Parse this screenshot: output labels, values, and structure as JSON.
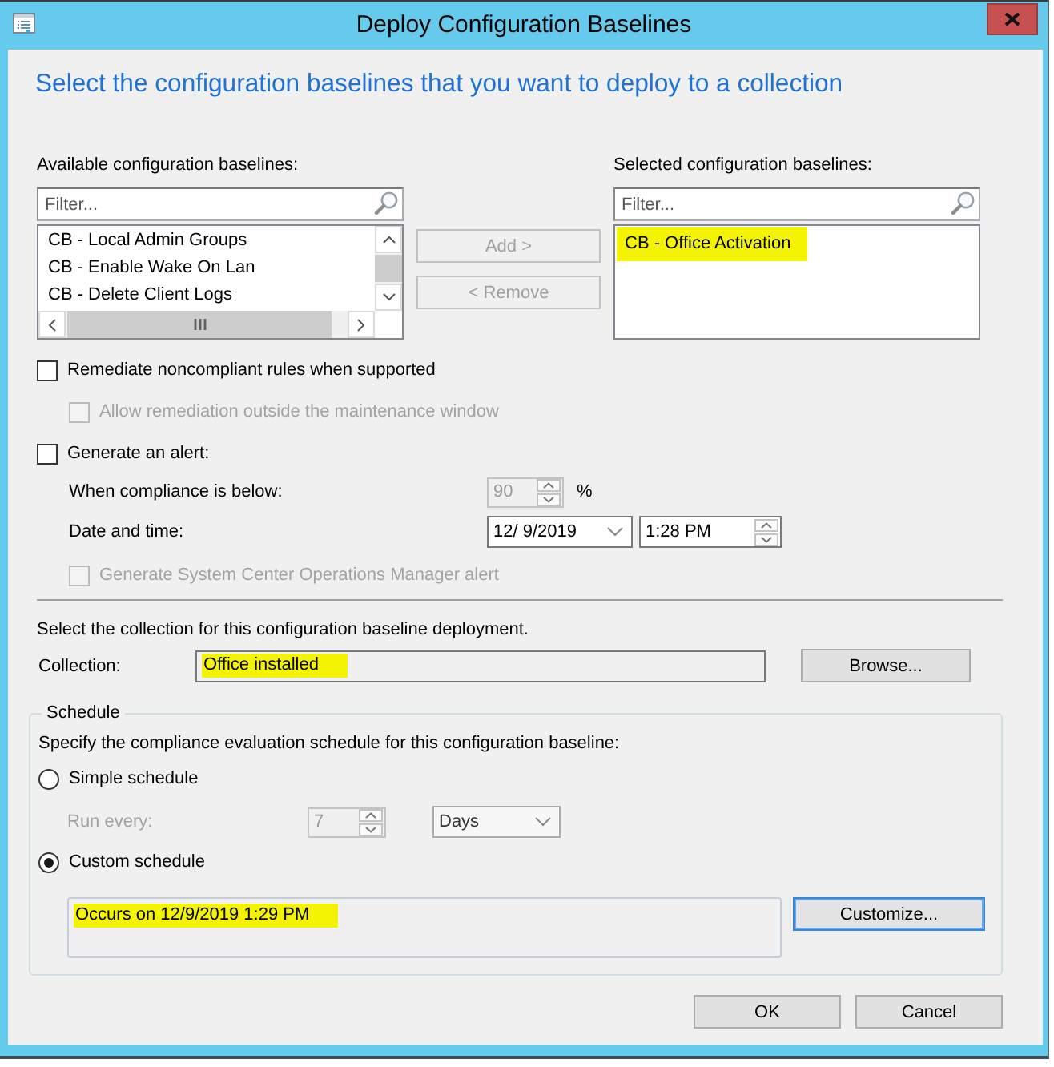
{
  "window": {
    "title": "Deploy Configuration Baselines"
  },
  "heading": "Select the configuration baselines that you want to deploy to a collection",
  "available": {
    "label": "Available configuration baselines:",
    "filter": {
      "placeholder": "Filter..."
    },
    "items": [
      {
        "text": "CB - Local Admin Groups",
        "selected": false
      },
      {
        "text": "CB - Enable Wake On Lan",
        "selected": false
      },
      {
        "text": "CB - Delete Client Logs",
        "selected": false
      }
    ]
  },
  "move_buttons": [
    {
      "label": "Add >",
      "disabled": true
    },
    {
      "label": "< Remove",
      "disabled": true
    }
  ],
  "chosen": {
    "label": "Selected configuration baselines:",
    "filter": {
      "placeholder": "Filter..."
    },
    "items": [
      {
        "text": "CB - Office Activation",
        "selected": false,
        "highlighted": true
      }
    ]
  },
  "options": [
    {
      "kind": "checkbox",
      "label": "Remediate noncompliant rules when supported",
      "checked": false,
      "disabled": false,
      "children": [
        {
          "kind": "checkbox",
          "label": "Allow remediation outside the maintenance window",
          "checked": false,
          "disabled": true
        }
      ]
    },
    {
      "kind": "checkbox",
      "label": "Generate an alert:",
      "checked": false,
      "disabled": false,
      "children": [
        {
          "kind": "spinner",
          "label": "When compliance is below:",
          "value": "90",
          "unit": "%",
          "disabled": true
        },
        {
          "kind": "datetime",
          "label": "Date and time:",
          "date": "12/ 9/2019",
          "time": "1:28 PM",
          "disabled": false
        },
        {
          "kind": "checkbox",
          "label": "Generate System Center Operations Manager alert",
          "checked": false,
          "disabled": true
        }
      ]
    }
  ],
  "collection": {
    "prompt": "Select the collection for this configuration baseline deployment.",
    "label": "Collection:",
    "value": "Office installed",
    "highlighted": true,
    "button": {
      "label": "Browse...",
      "focused": false
    }
  },
  "schedule": {
    "title": "Schedule",
    "prompt": "Specify the compliance evaluation schedule for this configuration baseline:",
    "options": [
      {
        "kind": "simple",
        "label": "Simple schedule",
        "selected": false,
        "interval": {
          "label": "Run every:",
          "value": "7",
          "unit": "Days",
          "disabled": true
        }
      },
      {
        "kind": "custom",
        "label": "Custom schedule",
        "selected": true,
        "summary": {
          "text": "Occurs on 12/9/2019 1:29 PM",
          "highlighted": true
        },
        "button": {
          "label": "Customize...",
          "focused": true
        }
      }
    ]
  },
  "footer_buttons": [
    {
      "label": "OK",
      "focused": false
    },
    {
      "label": "Cancel",
      "focused": false
    }
  ]
}
